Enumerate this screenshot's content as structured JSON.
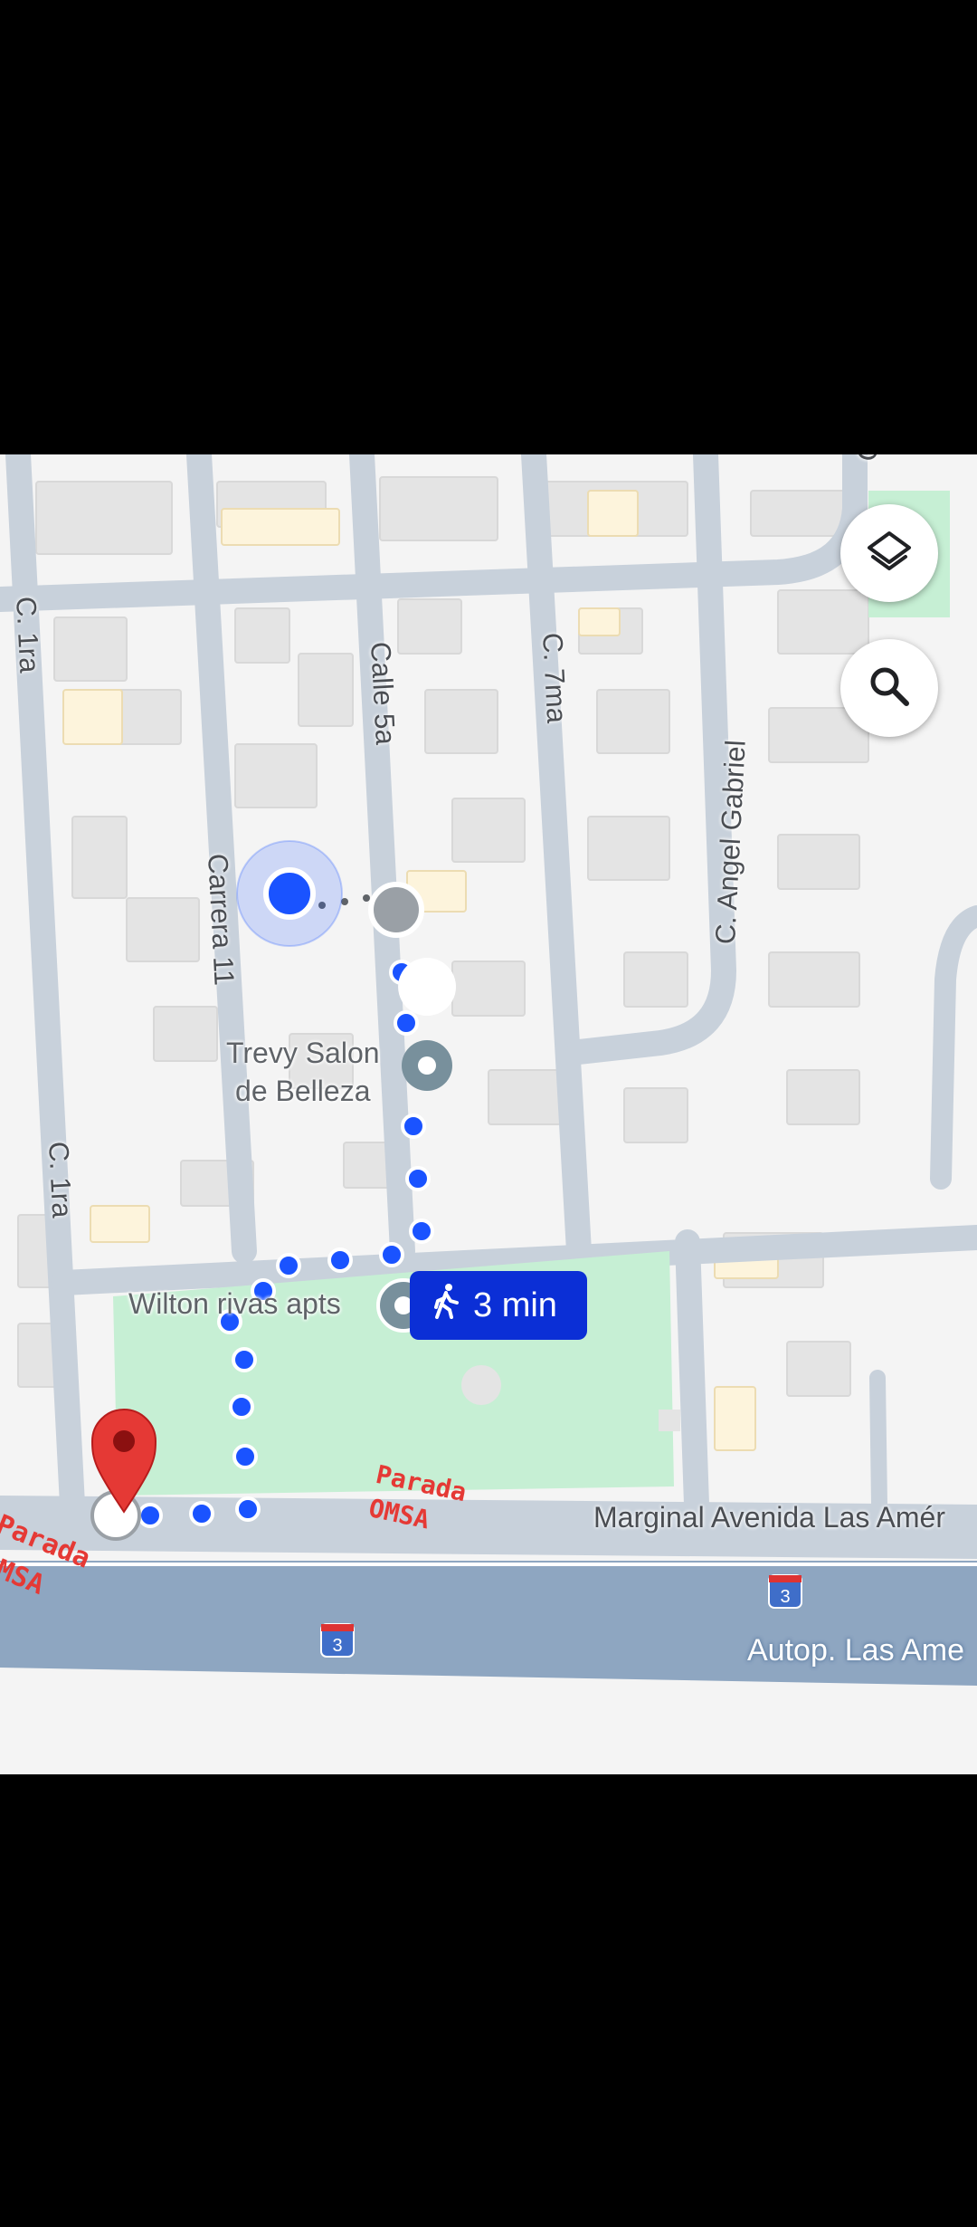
{
  "map": {
    "streets": {
      "c1ra_top": "C. 1ra",
      "c1ra_bottom": "C. 1ra",
      "carrera11": "Carrera 11",
      "calle5a": "Calle 5a",
      "c7ma": "C. 7ma",
      "angel_gabriel": "C. Angel Gabriel",
      "marginal": "Marginal Avenida Las Amér",
      "autopista": "Autop. Las Ame",
      "top_right_partial": "C"
    },
    "places": {
      "trevy_line1": "Trevy Salon",
      "trevy_line2": "de Belleza",
      "wilton": "Wilton rivas apts"
    },
    "route": {
      "mode_icon": "walking-person-icon",
      "duration": "3 min",
      "color": "#1a53ff"
    },
    "highway_shields": [
      "3",
      "3"
    ],
    "annotations": [
      {
        "line1": "Parada",
        "line2": "OMSA",
        "color": "#e53935"
      },
      {
        "line1": "Parada",
        "line2": "OMSA",
        "color": "#e53935"
      }
    ],
    "buttons": {
      "layers_icon": "layers-icon",
      "search_icon": "search-icon"
    },
    "colors": {
      "road": "#c5cfd9",
      "highway": "#8aa3bf",
      "park": "#c6efd4",
      "building": "#e6e6e6",
      "destination_pin": "#e53935"
    }
  }
}
